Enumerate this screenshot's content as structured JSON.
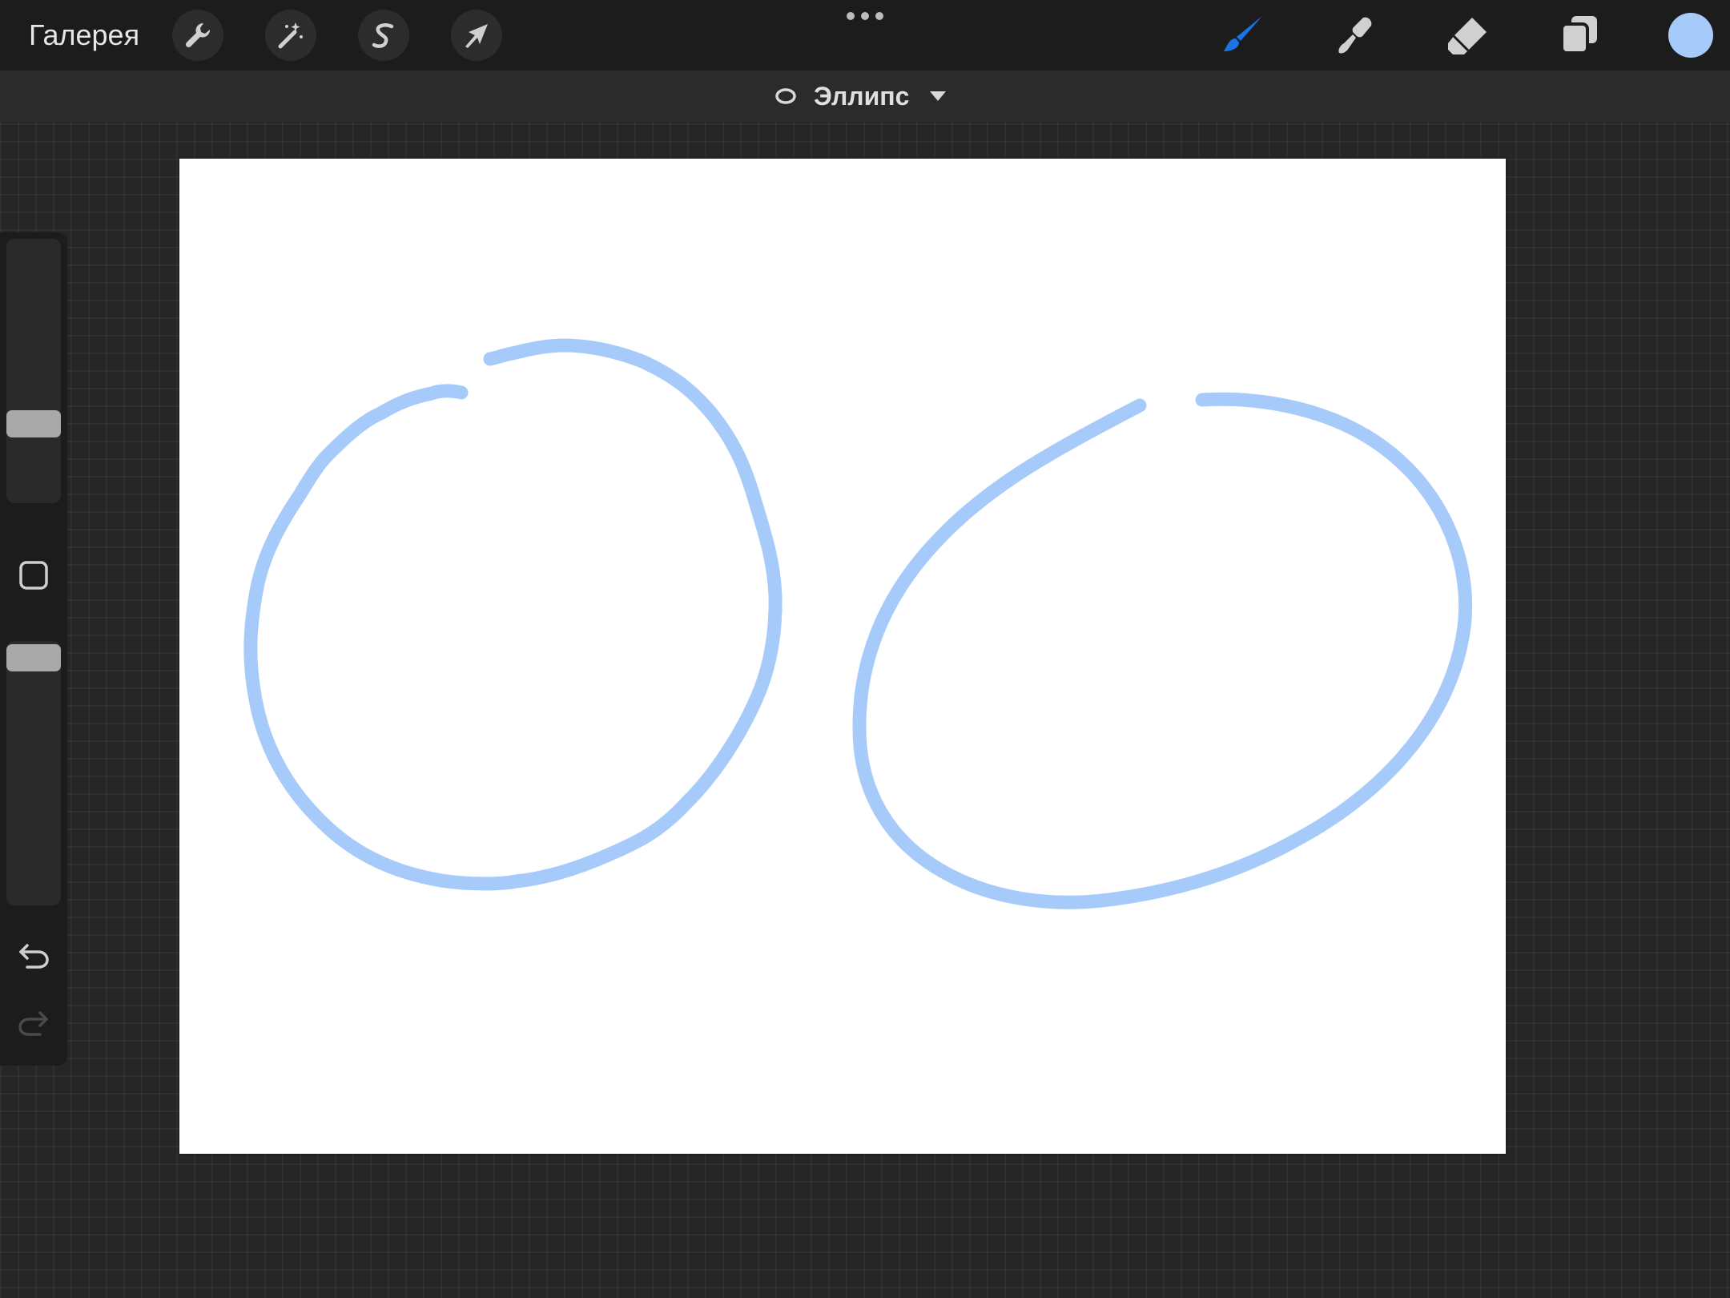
{
  "topbar": {
    "gallery_label": "Галерея",
    "left_tools": [
      {
        "icon": "wrench-icon",
        "name": "actions"
      },
      {
        "icon": "magic-wand-icon",
        "name": "adjustments"
      },
      {
        "icon": "selection-s-icon",
        "name": "selection"
      },
      {
        "icon": "arrow-cursor-icon",
        "name": "transform"
      }
    ],
    "more_icon": "ellipsis-icon",
    "right_tools": [
      {
        "icon": "brush-icon",
        "name": "paint",
        "active": true
      },
      {
        "icon": "smudge-icon",
        "name": "smudge",
        "active": false
      },
      {
        "icon": "eraser-icon",
        "name": "erase",
        "active": false
      },
      {
        "icon": "layers-icon",
        "name": "layers",
        "active": false
      }
    ],
    "active_color": "#a6cbfa",
    "accent_color": "#1b73e8"
  },
  "shapebar": {
    "shape_icon": "ellipse-icon",
    "shape_label": "Эллипс",
    "dropdown_icon": "caret-down-icon"
  },
  "canvas": {
    "background": "#ffffff",
    "stroke_color": "#a6cbfa"
  },
  "sidebar": {
    "brush_size_icon": "brush-size-slider",
    "opacity_icon": "opacity-slider",
    "modify_icon": "square-outline-icon",
    "undo_icon": "undo-arrow-icon",
    "redo_icon": "redo-arrow-icon"
  }
}
